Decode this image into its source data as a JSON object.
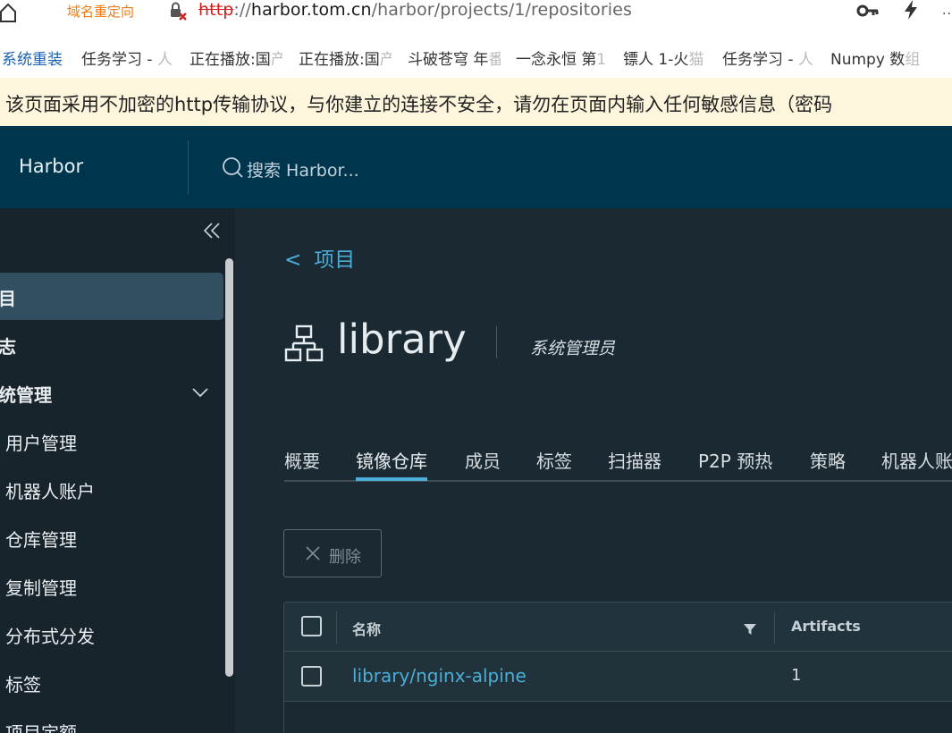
{
  "browser": {
    "redirect_label": "域名重定向",
    "url_protocol": "http",
    "url_sep": "://",
    "url_host": "harbor.tom.cn",
    "url_path": "/harbor/projects/1/repositories",
    "more_label": "··",
    "bookmarks": [
      {
        "label": "系统重装",
        "fade": ""
      },
      {
        "label": "任务学习 - ",
        "fade": "人"
      },
      {
        "label": "正在播放:国",
        "fade": "产"
      },
      {
        "label": "正在播放:国",
        "fade": "产"
      },
      {
        "label": "斗破苍穹 年",
        "fade": "番"
      },
      {
        "label": "一念永恒 第",
        "fade": "1"
      },
      {
        "label": "镖人 1-火",
        "fade": "猫"
      },
      {
        "label": "任务学习 - ",
        "fade": "人"
      },
      {
        "label": "Numpy 数",
        "fade": "组"
      }
    ],
    "warning": "该页面采用不加密的http传输协议，与你建立的连接不安全，请勿在页面内输入任何敏感信息（密码"
  },
  "header": {
    "app_title": "Harbor",
    "search_placeholder": "搜索 Harbor..."
  },
  "sidebar": {
    "items": [
      {
        "label": "目",
        "bold": true,
        "active": true
      },
      {
        "label": "志",
        "bold": true
      },
      {
        "label": "统管理",
        "bold": true,
        "expanded": true
      },
      {
        "label": "用户管理"
      },
      {
        "label": "机器人账户"
      },
      {
        "label": "仓库管理"
      },
      {
        "label": "复制管理"
      },
      {
        "label": "分布式分发"
      },
      {
        "label": "标签"
      },
      {
        "label": "项目定额"
      }
    ]
  },
  "main": {
    "back_chevron": "<",
    "back_label": "项目",
    "project_name": "library",
    "role": "系统管理员",
    "tabs": [
      {
        "label": "概要"
      },
      {
        "label": "镜像仓库",
        "active": true
      },
      {
        "label": "成员"
      },
      {
        "label": "标签"
      },
      {
        "label": "扫描器"
      },
      {
        "label": "P2P 预热"
      },
      {
        "label": "策略"
      },
      {
        "label": "机器人账"
      }
    ],
    "delete_label": "删除",
    "grid": {
      "columns": [
        "名称",
        "Artifacts"
      ],
      "rows": [
        {
          "name": "library/nginx-alpine",
          "artifacts": "1"
        }
      ]
    }
  },
  "colors": {
    "header_bg": "#00364d",
    "sidebar_bg": "#17242b",
    "main_bg": "#1b2a32",
    "accent": "#4aaed9",
    "warning_bg": "#fdf6dd",
    "redirect_label": "#f07a12"
  }
}
